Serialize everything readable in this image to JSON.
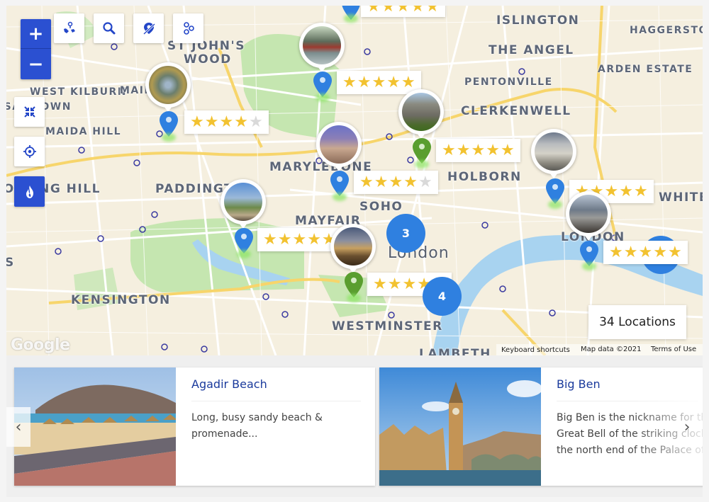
{
  "map": {
    "places": [
      {
        "id": "islington",
        "label": "ISLINGTON",
        "size": "lg"
      },
      {
        "id": "haggerston",
        "label": "HAGGERSTON",
        "size": "md"
      },
      {
        "id": "st-johns-wood-1",
        "label": "ST JOHN'S",
        "size": "lg"
      },
      {
        "id": "st-johns-wood-2",
        "label": "WOOD",
        "size": "lg"
      },
      {
        "id": "the-angel",
        "label": "THE ANGEL",
        "size": "lg"
      },
      {
        "id": "arden-estate",
        "label": "ARDEN ESTATE",
        "size": "md"
      },
      {
        "id": "west-kilburn",
        "label": "WEST KILBURN",
        "size": "md"
      },
      {
        "id": "maida-vale",
        "label": "MAID",
        "size": "md"
      },
      {
        "id": "pentonville",
        "label": "PENTONVILLE",
        "size": "md"
      },
      {
        "id": "kensal-town",
        "label": "KENSAL TOWN",
        "size": "md"
      },
      {
        "id": "clerkenwell",
        "label": "CLERKENWELL",
        "size": "lg"
      },
      {
        "id": "maida-hill",
        "label": "MAIDA HILL",
        "size": "md"
      },
      {
        "id": "marylebone",
        "label": "MARYLEBONE",
        "size": "lg"
      },
      {
        "id": "holborn",
        "label": "HOLBORN",
        "size": "lg"
      },
      {
        "id": "notting-hill",
        "label": "NOTTING HILL",
        "size": "lg"
      },
      {
        "id": "paddington",
        "label": "PADDINGTON",
        "size": "lg"
      },
      {
        "id": "soho",
        "label": "SOHO",
        "size": "lg"
      },
      {
        "id": "whitechapel",
        "label": "WHITE",
        "size": "lg"
      },
      {
        "id": "mayfair",
        "label": "MAYFAIR",
        "size": "lg"
      },
      {
        "id": "city-of-london",
        "label": "CITY OF LONDON",
        "size": "lg"
      },
      {
        "id": "london",
        "label": "London",
        "size": "city"
      },
      {
        "id": "kensington",
        "label": "KENSINGTON",
        "size": "lg"
      },
      {
        "id": "westminster",
        "label": "WESTMINSTER",
        "size": "lg"
      },
      {
        "id": "lambeth",
        "label": "LAMBETH",
        "size": "lg"
      },
      {
        "id": "chelsea",
        "label": "S",
        "size": "lg"
      }
    ],
    "markers": [
      {
        "id": "top-cut",
        "pin_color": "#2f80e0",
        "rating": 5
      },
      {
        "id": "regents-canal",
        "pin_color": "#2f80e0",
        "rating": 5
      },
      {
        "id": "little-venice",
        "pin_color": "#2f80e0",
        "rating": 4
      },
      {
        "id": "british-museum",
        "pin_color": "#5a9e2f",
        "rating": 5
      },
      {
        "id": "oxford-street",
        "pin_color": "#2f80e0",
        "rating": 4
      },
      {
        "id": "st-pauls",
        "pin_color": "#2f80e0",
        "rating": 5
      },
      {
        "id": "hyde-park",
        "pin_color": "#2f80e0",
        "rating": 5
      },
      {
        "id": "buckingham-palace",
        "pin_color": "#5a9e2f",
        "rating": 4
      },
      {
        "id": "tower-of-london",
        "pin_color": "#2f80e0",
        "rating": 5
      }
    ],
    "clusters": [
      {
        "id": "cluster-soho",
        "count": "3"
      },
      {
        "id": "cluster-westminster",
        "count": "4"
      },
      {
        "id": "cluster-east",
        "count": ""
      }
    ],
    "location_count": "34 Locations",
    "google_logo": "Google",
    "attribution": {
      "keyboard": "Keyboard shortcuts",
      "map_data": "Map data ©2021",
      "terms": "Terms of Use"
    }
  },
  "controls": {
    "zoom_in": "+",
    "zoom_out": "−",
    "toolbar": [
      {
        "id": "explore",
        "icon": "world-pin-icon"
      },
      {
        "id": "search",
        "icon": "search-icon"
      },
      {
        "id": "hide-marker",
        "icon": "marker-off-icon"
      },
      {
        "id": "nearby",
        "icon": "multi-pin-icon"
      }
    ],
    "side": [
      {
        "id": "fit-bounds",
        "icon": "collapse-arrows-icon"
      },
      {
        "id": "locate",
        "icon": "crosshair-icon"
      },
      {
        "id": "heatmap",
        "icon": "flame-icon",
        "active": true
      }
    ]
  },
  "cards": [
    {
      "title": "Agadir Beach",
      "desc_lines": [
        "Long, busy sandy beach &",
        "promenade..."
      ]
    },
    {
      "title": "Big Ben",
      "desc_lines": [
        "Big Ben is the nickname for the",
        "Great Bell of the striking clock at",
        "the north end of the Palace of"
      ]
    }
  ],
  "carousel": {
    "prev": "‹",
    "next": "›"
  },
  "colors": {
    "accent": "#2b50d1",
    "pin_blue": "#2f80e0",
    "pin_green": "#5a9e2f",
    "star": "#f2c230",
    "title": "#1a3a9c"
  }
}
